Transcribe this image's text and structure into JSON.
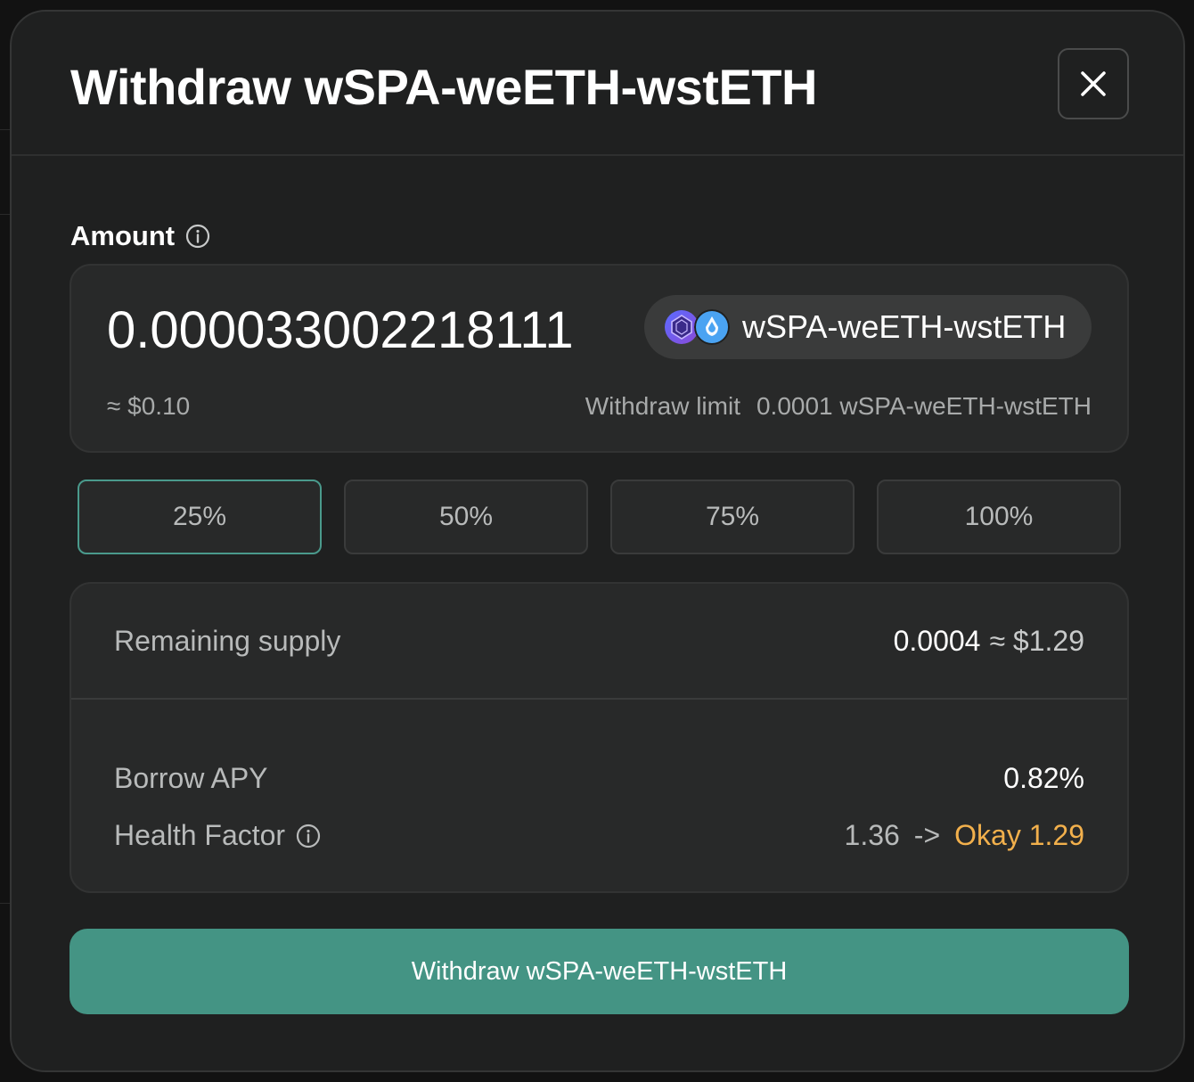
{
  "modal": {
    "title": "Withdraw wSPA-weETH-wstETH",
    "close_icon": "close-icon"
  },
  "amount": {
    "label": "Amount",
    "info_icon": "info-icon",
    "value": "0.000033002218111",
    "token": "wSPA-weETH-wstETH",
    "usd_estimate": "≈ $0.10",
    "limit_label": "Withdraw limit",
    "limit_value": "0.0001 wSPA-weETH-wstETH"
  },
  "percent_buttons": [
    {
      "label": "25%",
      "active": true
    },
    {
      "label": "50%",
      "active": false
    },
    {
      "label": "75%",
      "active": false
    },
    {
      "label": "100%",
      "active": false
    }
  ],
  "details": {
    "remaining_supply_label": "Remaining supply",
    "remaining_supply_amount": "0.0004",
    "remaining_supply_usd": "≈ $1.29",
    "borrow_apy_label": "Borrow APY",
    "borrow_apy_value": "0.82%",
    "health_factor_label": "Health Factor",
    "health_factor_current": "1.36",
    "health_factor_arrow": "->",
    "health_factor_new": "Okay 1.29"
  },
  "submit": {
    "label": "Withdraw wSPA-weETH-wstETH"
  },
  "colors": {
    "accent": "#449484",
    "active_border": "#4a9a8c",
    "warning": "#f2b04c",
    "background": "#1f2020"
  }
}
